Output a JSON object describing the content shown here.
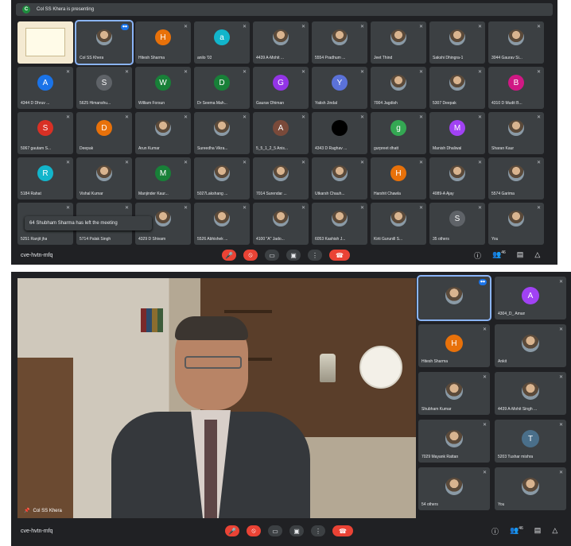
{
  "top": {
    "presenting": "Col SS Khera is presenting",
    "presenting_icon": "C",
    "tiles": [
      {
        "type": "slides",
        "name": ""
      },
      {
        "type": "photo",
        "name": "Col SS Khera",
        "active": true
      },
      {
        "type": "letter",
        "letter": "H",
        "color": "#e8710a",
        "name": "Hitesh Sharma"
      },
      {
        "type": "letter",
        "letter": "a",
        "color": "#12b5cb",
        "name": "anilo '03"
      },
      {
        "type": "photo",
        "name": "4439 A-Mohit ..."
      },
      {
        "type": "photo",
        "name": "5554 Pradhum ..."
      },
      {
        "type": "photo",
        "name": "Jeet Thind"
      },
      {
        "type": "photo",
        "name": "Sakshi Dhingra-1"
      },
      {
        "type": "photo",
        "name": "3044 Gaurav Si..."
      },
      {
        "type": "letter",
        "letter": "A",
        "color": "#1a73e8",
        "name": "4344 D Dhruv ..."
      },
      {
        "type": "letter",
        "letter": "S",
        "color": "#5f6368",
        "name": "5625 Himanshu..."
      },
      {
        "type": "letter",
        "letter": "W",
        "color": "#188038",
        "name": "William Forsun"
      },
      {
        "type": "letter",
        "letter": "D",
        "color": "#188038",
        "name": "Dr Seema Mah..."
      },
      {
        "type": "letter",
        "letter": "G",
        "color": "#9334e6",
        "name": "Gaurav Dhiman"
      },
      {
        "type": "letter",
        "letter": "Y",
        "color": "#5b72d9",
        "name": "Yatish Jindal"
      },
      {
        "type": "photo",
        "name": "7004 Jagdish"
      },
      {
        "type": "photo",
        "name": "5307 Deepak"
      },
      {
        "type": "letter",
        "letter": "B",
        "color": "#d01884",
        "name": "4310 D Mudit B..."
      },
      {
        "type": "letter",
        "letter": "S",
        "color": "#d93025",
        "name": "5067 gautam S..."
      },
      {
        "type": "letter",
        "letter": "D",
        "color": "#e8710a",
        "name": "Deepak"
      },
      {
        "type": "photo",
        "name": "Arun Kumar"
      },
      {
        "type": "photo",
        "name": "Sureedha Vikra..."
      },
      {
        "type": "letter",
        "letter": "A",
        "color": "#7a4a3a",
        "name": "5_5_1_2_5 Anis..."
      },
      {
        "type": "dark",
        "name": "4343 D Raghav ..."
      },
      {
        "type": "letter",
        "letter": "g",
        "color": "#34a853",
        "name": "gurpreet dhatt"
      },
      {
        "type": "letter",
        "letter": "M",
        "color": "#a142f4",
        "name": "Manish Dhaliwal"
      },
      {
        "type": "photo",
        "name": "Sharan Kaur"
      },
      {
        "type": "letter",
        "letter": "R",
        "color": "#12b5cb",
        "name": "5184 Rahat"
      },
      {
        "type": "photo",
        "name": "Vishal Kumar"
      },
      {
        "type": "letter",
        "letter": "M",
        "color": "#188038",
        "name": "Manjinder Kaur..."
      },
      {
        "type": "photo",
        "name": "5027Lakshang ..."
      },
      {
        "type": "photo",
        "name": "7014 Surendar ..."
      },
      {
        "type": "photo",
        "name": "Utkarsh Chauh..."
      },
      {
        "type": "letter",
        "letter": "H",
        "color": "#e8710a",
        "name": "Harshit Chawla"
      },
      {
        "type": "photo",
        "name": "4089-A Ajay"
      },
      {
        "type": "photo",
        "name": "5574 Garima"
      },
      {
        "type": "blank",
        "name": "5251 Ranjit jha"
      },
      {
        "type": "blank",
        "name": "5714 Palak Singh"
      },
      {
        "type": "avatar",
        "name": "4329 D Shivam"
      },
      {
        "type": "photo",
        "name": "5526 Abhishek ..."
      },
      {
        "type": "photo",
        "name": "4100 \"A\" Jado..."
      },
      {
        "type": "photo",
        "name": "6053 Kashish J..."
      },
      {
        "type": "photo",
        "name": "Kirti Gurunill S..."
      },
      {
        "type": "others",
        "letter": "S",
        "name": "35 others"
      },
      {
        "type": "photo",
        "name": "You"
      }
    ],
    "toast": "64 Shubham Sharma has left the meeting",
    "meeting_code": "cve-hvtn-mfq",
    "people_badge": "46"
  },
  "bottom": {
    "video_name": "Col SS Khera",
    "meeting_code": "cve-hvtn-mfq",
    "people_badge": "46",
    "tiles": [
      {
        "type": "photo",
        "name": "",
        "active": true
      },
      {
        "type": "letter",
        "letter": "A",
        "color": "#a142f4",
        "name": "4304_D_ Aman"
      },
      {
        "type": "letter",
        "letter": "H",
        "color": "#e8710a",
        "name": "Hitesh Sharma"
      },
      {
        "type": "photo",
        "name": "Ankit"
      },
      {
        "type": "photo",
        "name": "Shubham Kumar"
      },
      {
        "type": "photo",
        "name": "4439 A-Mohit Singh ..."
      },
      {
        "type": "photo",
        "name": "7029 Mayank Rattan"
      },
      {
        "type": "letter",
        "letter": "T",
        "color": "#4a6f8a",
        "name": "5203 Tushar mishra"
      },
      {
        "type": "photo",
        "name": "54 others"
      },
      {
        "type": "photo",
        "name": "You"
      }
    ]
  }
}
